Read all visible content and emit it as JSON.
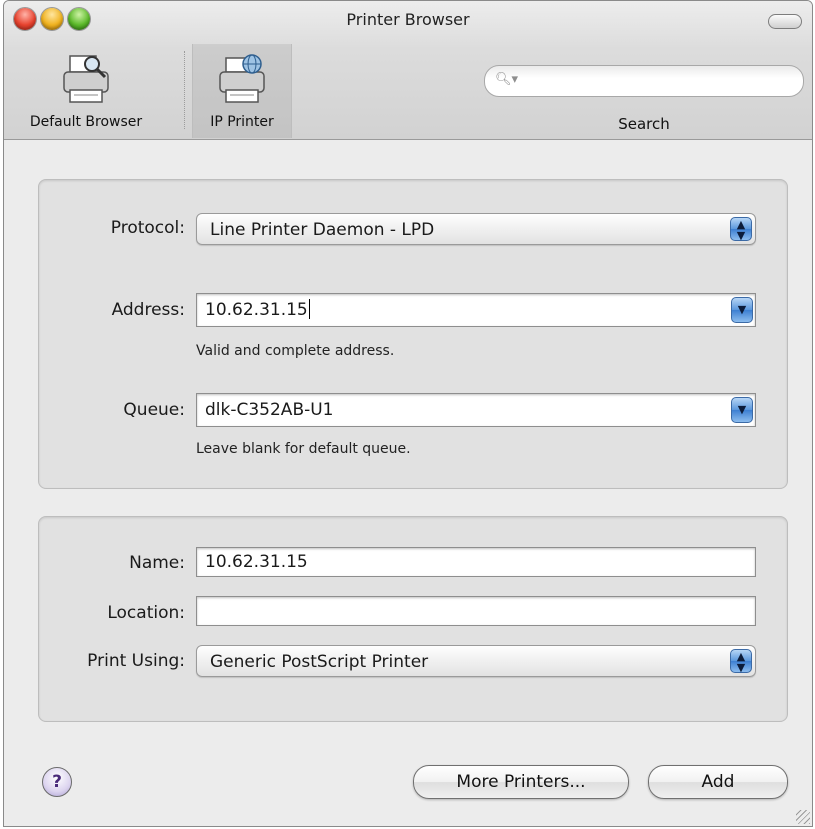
{
  "window": {
    "title": "Printer Browser"
  },
  "toolbar": {
    "default_browser_label": "Default Browser",
    "ip_printer_label": "IP Printer",
    "search_label": "Search",
    "search_placeholder": "",
    "search_icon": "magnifier-icon"
  },
  "ip_settings": {
    "protocol_label": "Protocol:",
    "protocol_value": "Line Printer Daemon - LPD",
    "address_label": "Address:",
    "address_value": "10.62.31.15",
    "address_hint": "Valid and complete address.",
    "queue_label": "Queue:",
    "queue_value": "dlk-C352AB-U1",
    "queue_hint": "Leave blank for default queue."
  },
  "printer_info": {
    "name_label": "Name:",
    "name_value": "10.62.31.15",
    "location_label": "Location:",
    "location_value": "",
    "print_using_label": "Print Using:",
    "print_using_value": "Generic PostScript Printer"
  },
  "footer": {
    "help_label": "?",
    "more_printers_label": "More Printers...",
    "add_label": "Add"
  },
  "colors": {
    "accent_blue": "#3d7fd2",
    "panel_gray": "#e1e1e1",
    "window_gray": "#ececec"
  }
}
